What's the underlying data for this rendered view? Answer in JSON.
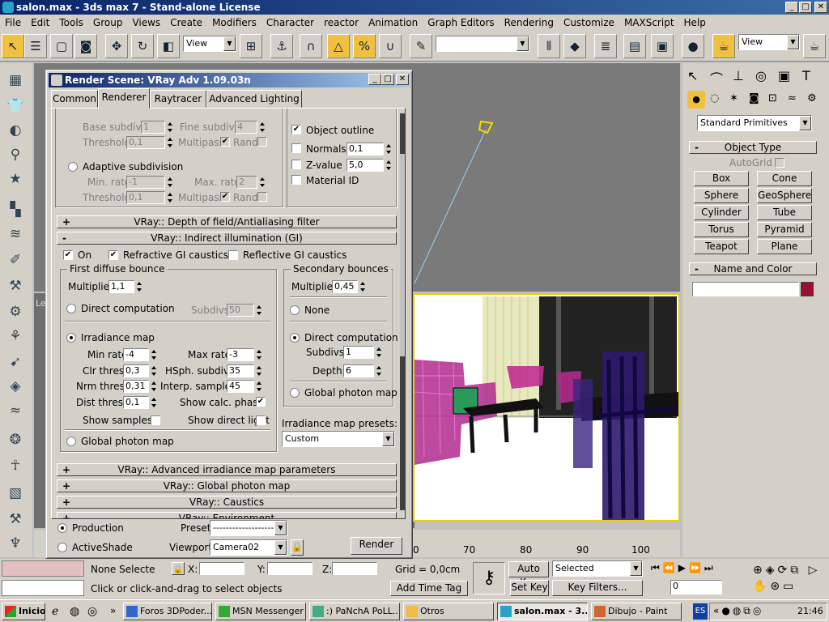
{
  "window": {
    "title": "salon.max - 3ds max 7  - Stand-alone License",
    "min": "_",
    "max": "□",
    "close": "✕"
  },
  "menu": [
    "File",
    "Edit",
    "Tools",
    "Group",
    "Views",
    "Create",
    "Modifiers",
    "Character",
    "reactor",
    "Animation",
    "Graph Editors",
    "Rendering",
    "Customize",
    "MAXScript",
    "Help"
  ],
  "toolbar": {
    "refcoord": "View",
    "selset": "",
    "view2": "View"
  },
  "viewport": {
    "cam_label": "Le",
    "ruler": [
      "70",
      "80",
      "90",
      "100"
    ],
    "ruler0": "0"
  },
  "command_panel": {
    "category": "Standard Primitives",
    "object_type": "Object Type",
    "autogrid": "AutoGrid",
    "buttons": [
      "Box",
      "Cone",
      "Sphere",
      "GeoSphere",
      "Cylinder",
      "Tube",
      "Torus",
      "Pyramid",
      "Teapot",
      "Plane"
    ],
    "name_color": "Name and Color",
    "name_value": "",
    "color": "#9b1030"
  },
  "dialog": {
    "title": "Render Scene: VRay Adv 1.09.03n",
    "tabs": [
      "Common",
      "Renderer",
      "Raytracer",
      "Advanced Lighting"
    ],
    "top": {
      "base_subdivs": "Base subdivs:",
      "base_subdivs_val": "1",
      "fine_subdivs": "Fine subdivs:",
      "fine_subdivs_val": "4",
      "threshold": "Threshold:",
      "threshold_val": "0,1",
      "multipass": "Multipass",
      "rand": "Rand",
      "adaptive": "Adaptive subdivision",
      "min_rate": "Min. rate:",
      "min_rate_val": "-1",
      "max_rate": "Max. rate:",
      "max_rate_val": "2",
      "threshold2_val": "0,1"
    },
    "right": {
      "object_outline": "Object outline",
      "normals": "Normals",
      "normals_val": "0,1",
      "zvalue": "Z-value",
      "zvalue_val": "5,0",
      "material_id": "Material ID"
    },
    "rollouts": {
      "dof": "VRay:: Depth of field/Antialiasing filter",
      "gi": "VRay:: Indirect illumination (GI)",
      "adv_irr": "VRay:: Advanced irradiance map parameters",
      "global_photon": "VRay:: Global photon map",
      "caustics": "VRay:: Caustics",
      "environment": "VRay:: Environment"
    },
    "gi": {
      "on": "On",
      "refractive": "Refractive GI caustics",
      "reflective": "Reflective GI caustics",
      "first": "First diffuse bounce",
      "multiplier": "Multiplier:",
      "first_mult": "1,1",
      "direct": "Direct computation",
      "subdivs": "Subdivs:",
      "subdivs_val": "50",
      "irradiance": "Irradiance map",
      "min_rate": "Min rate:",
      "min_rate_val": "-4",
      "max_rate": "Max rate:",
      "max_rate_val": "-3",
      "clr": "Clr thresh:",
      "clr_val": "0,3",
      "hsph": "HSph. subdivs:",
      "hsph_val": "35",
      "nrm": "Nrm thresh:",
      "nrm_val": "0,31",
      "interp": "Interp. samples:",
      "interp_val": "45",
      "dist": "Dist thresh:",
      "dist_val": "0,1",
      "show_calc": "Show calc. phase",
      "show_samples": "Show samples",
      "show_direct": "Show direct light",
      "global_photon": "Global photon map",
      "secondary": "Secondary bounces",
      "sec_mult": "0,45",
      "none": "None",
      "sec_direct": "Direct computation",
      "sec_subdivs": "Subdivs:",
      "sec_subdivs_val": "1",
      "depth": "Depth:",
      "depth_val": "6",
      "sec_global": "Global photon map",
      "presets": "Irradiance map presets:",
      "preset_val": "Custom"
    },
    "bottom": {
      "production": "Production",
      "activeshade": "ActiveShade",
      "preset": "Preset:",
      "preset_val": "-------------------",
      "viewport": "Viewport:",
      "viewport_val": "Camera02",
      "render": "Render"
    }
  },
  "status": {
    "none_selected": "None Selecte",
    "x": "X:",
    "y": "Y:",
    "z": "Z:",
    "grid": "Grid = 0,0cm",
    "autokey": "Auto Key",
    "selected": "Selected",
    "setkey": "Set Key",
    "keyfilters": "Key Filters...",
    "frame": "0",
    "prompt": "Click or click-and-drag to select objects",
    "addtime": "Add Time Tag"
  },
  "taskbar": {
    "start": "Inicio",
    "items": [
      "Foros 3DPoder...",
      "MSN Messenger",
      ":) PaNchA PoLL...",
      "Otros",
      "salon.max - 3...",
      "Dibujo - Paint"
    ],
    "lang": "ES",
    "clock": "21:46"
  }
}
